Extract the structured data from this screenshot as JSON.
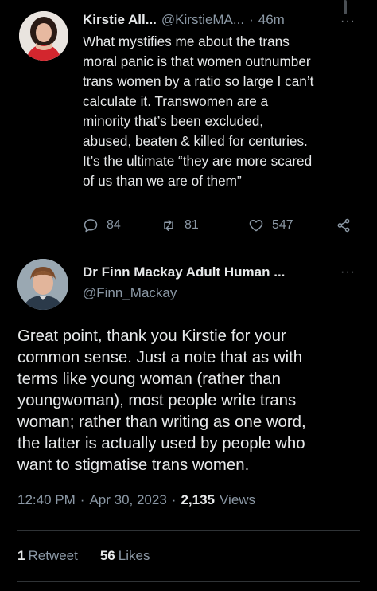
{
  "tweet1": {
    "author_name": "Kirstie All...",
    "author_handle": "@KirstieMA...",
    "separator": "·",
    "time": "46m",
    "more": "···",
    "body_lines": [
      "What mystifies me about the trans",
      "moral panic is that women outnumber",
      "trans women by a ratio so large I can’t",
      "calculate it. Transwomen are a",
      "minority that’s been excluded,",
      "abused, beaten & killed for centuries.",
      "It’s the ultimate “they are more scared",
      "of us than we are of them”"
    ],
    "actions": {
      "replies": "84",
      "retweets": "81",
      "likes": "547",
      "reply_icon": "reply-icon",
      "retweet_icon": "retweet-icon",
      "like_icon": "heart-icon",
      "share_icon": "share-icon"
    }
  },
  "tweet2": {
    "author_name": "Dr Finn Mackay Adult Human ...",
    "author_handle": "@Finn_Mackay",
    "more": "···",
    "body_lines": [
      "Great point, thank you Kirstie for your",
      "common sense. Just a note that as with",
      "terms like young woman (rather than",
      "youngwoman), most people write trans",
      "woman; rather than writing as one word,",
      "the latter is actually used by people who",
      "want to stigmatise trans women."
    ],
    "time": "12:40 PM",
    "separator": "·",
    "date": "Apr 30, 2023",
    "views_count": "2,135",
    "views_label": "Views",
    "retweet_count": "1",
    "retweet_label": "Retweet",
    "like_count": "56",
    "like_label": "Likes"
  },
  "colors": {
    "background": "#000000",
    "text": "#e7e9ea",
    "secondary": "#8b98a5",
    "divider": "#2f3336"
  }
}
